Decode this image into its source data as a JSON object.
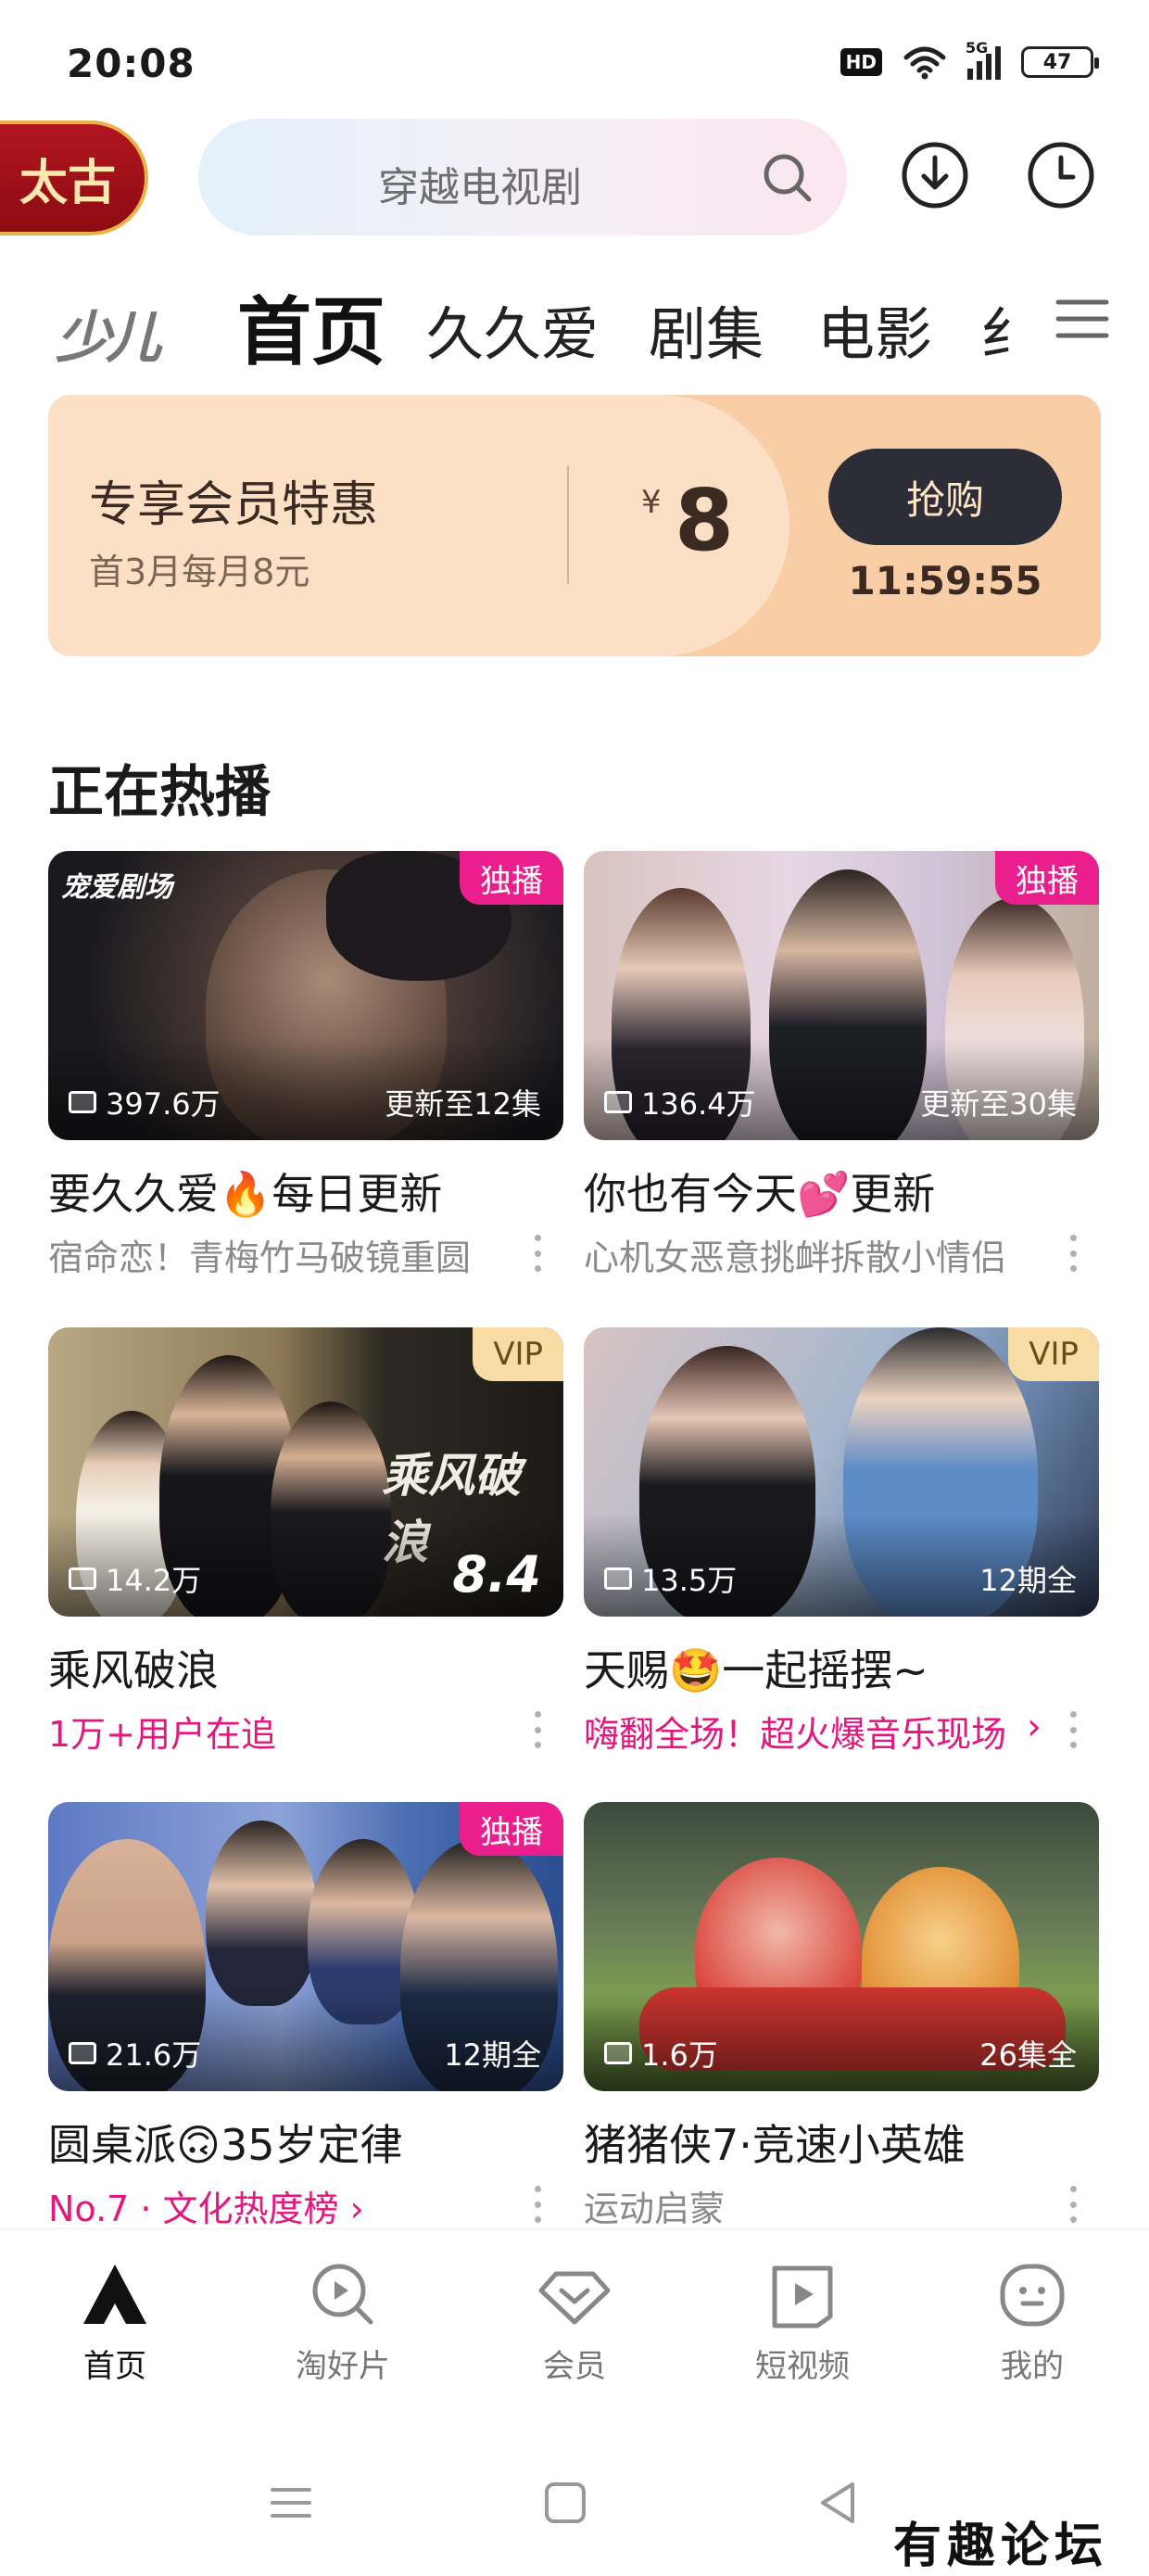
{
  "status_bar": {
    "time": "20:08",
    "hd": "HD",
    "network": "5G",
    "battery": "47"
  },
  "header": {
    "logo_text": "太古",
    "search_placeholder": "穿越电视剧"
  },
  "tabs": {
    "kids": "少儿",
    "items": [
      "首页",
      "久久爱",
      "剧集",
      "电影",
      "纟"
    ]
  },
  "promo": {
    "title": "专享会员特惠",
    "subtitle": "首3月每月8元",
    "currency": "¥",
    "price": "8",
    "button": "抢购",
    "countdown": "11:59:55"
  },
  "section": {
    "title": "正在热播"
  },
  "cards": [
    {
      "badge": "独播",
      "views": "397.6万",
      "corner": "更新至12集",
      "title": "要久久爱🔥每日更新",
      "subtitle": "宿命恋！青梅竹马破镜重圆",
      "logo": "宠爱剧场"
    },
    {
      "badge": "独播",
      "views": "136.4万",
      "corner": "更新至30集",
      "title": "你也有今天💕更新",
      "subtitle": "心机女恶意挑衅拆散小情侣"
    },
    {
      "badge": "VIP",
      "views": "14.2万",
      "corner": "8.4",
      "title": "乘风破浪",
      "subtitle": "1万+用户在追",
      "art_text": "乘风破浪"
    },
    {
      "badge": "VIP",
      "views": "13.5万",
      "corner": "12期全",
      "title": "天赐🤩一起摇摆~",
      "subtitle": "嗨翻全场！超火爆音乐现场"
    },
    {
      "badge": "独播",
      "views": "21.6万",
      "corner": "12期全",
      "title": "圆桌派🙃35岁定律",
      "subtitle": "No.7 · 文化热度榜 ›"
    },
    {
      "badge": "",
      "views": "1.6万",
      "corner": "26集全",
      "title": "猪猪侠7·竞速小英雄",
      "subtitle": "运动启蒙"
    }
  ],
  "bottom_nav": [
    "首页",
    "淘好片",
    "会员",
    "短视频",
    "我的"
  ],
  "watermark": "有趣论坛",
  "colors": {
    "accent_pink": "#e3177e",
    "promo_bg": "#f9cda6",
    "button_dark": "#2c2d36",
    "logo_red": "#b2161e"
  }
}
